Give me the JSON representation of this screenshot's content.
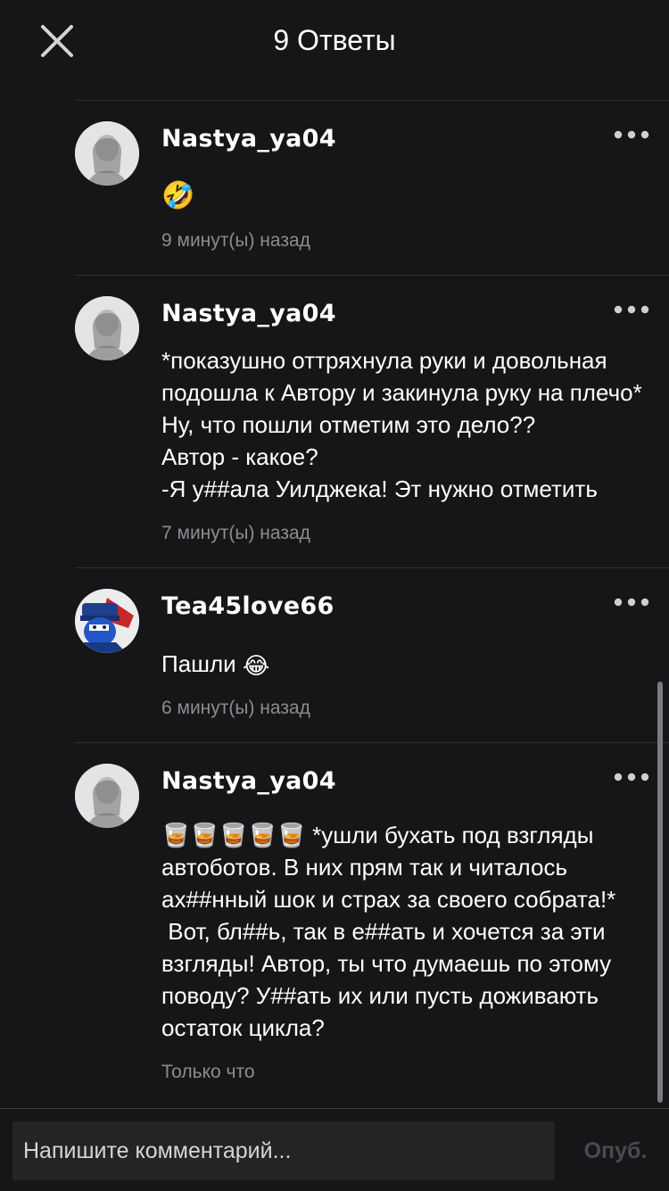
{
  "header": {
    "title": "9 Ответы",
    "close_icon": "close-icon"
  },
  "comments": [
    {
      "username": "Nastya_ya04",
      "text": "🤣",
      "time": "9 минут(ы) назад",
      "avatar": "girl-photo-avatar"
    },
    {
      "username": "Nastya_ya04",
      "text": "*показушно оттряхнула руки и довольная подошла к Автору и закинула руку на плечо* Ну, что пошли отметим это дело??\nАвтор - какое?\n-Я у##ала Уилджека! Эт нужно отметить",
      "time": "7 минут(ы) назад",
      "avatar": "girl-photo-avatar"
    },
    {
      "username": "Tea45love66",
      "text": "Пашли",
      "emoji": "😂",
      "time": "6 минут(ы) назад",
      "avatar": "cartoon-character-avatar"
    },
    {
      "username": "Nastya_ya04",
      "emoji_prefix": "🥃🥃🥃🥃🥃",
      "text": " *ушли бухать под взгляды автоботов. В них прям так и читалось ах##нный шок и страх за своего собрата!*\n Вот, бл##ь, так в е##ать и хочется за эти взгляды! Автор, ты что думаешь по этому поводу? У##ать их или пусть доживають остаток цикла?",
      "time": "Только что",
      "avatar": "girl-photo-avatar"
    }
  ],
  "footer": {
    "placeholder": "Напишите комментарий...",
    "publish_label": "Опуб."
  },
  "colors": {
    "background": "#161618",
    "separator": "#2f2f33",
    "muted_text": "#8c8c90",
    "input_bg": "#242427"
  }
}
